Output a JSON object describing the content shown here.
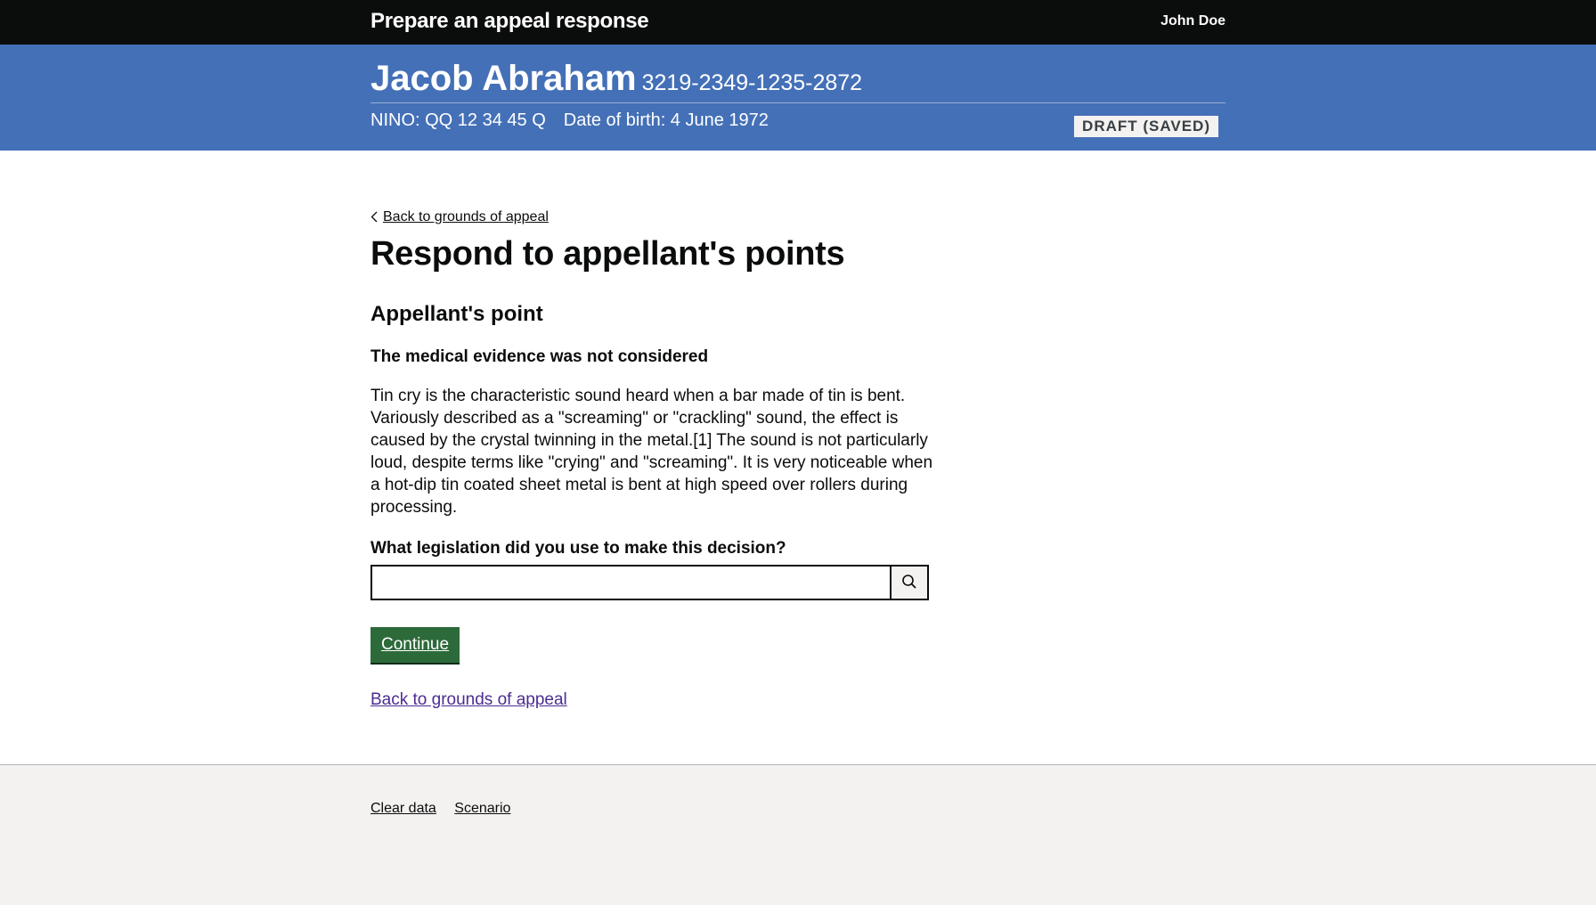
{
  "header": {
    "service_name": "Prepare an appeal response",
    "user_name": "John Doe"
  },
  "case_banner": {
    "name": "Jacob Abraham",
    "reference": "3219-2349-1235-2872",
    "status": "DRAFT (SAVED)",
    "nino": "NINO: QQ 12 34 45 Q",
    "dob": "Date of birth: 4 June 1972"
  },
  "main": {
    "back_link": "Back to grounds of appeal",
    "title": "Respond to appellant's points",
    "section_heading": "Appellant's point",
    "point_title": "The medical evidence was not considered",
    "point_body": "Tin cry is the characteristic sound heard when a bar made of tin is bent. Variously described as a \"screaming\" or \"crackling\" sound, the effect is caused by the crystal twinning in the metal.[1] The sound is not particularly loud, despite terms like \"crying\" and \"screaming\". It is very noticeable when a hot-dip tin coated sheet metal is bent at high speed over rollers during processing.",
    "legislation_label": "What legislation did you use to make this decision?",
    "legislation_value": "",
    "continue_label": "Continue",
    "back_link_bottom": "Back to grounds of appeal"
  },
  "footer": {
    "links": [
      "Clear data",
      "Scenario"
    ]
  },
  "colors": {
    "header_bg": "#0b0c0c",
    "banner_bg": "#4470b7",
    "button_bg": "#2d6a3a",
    "link_visited": "#4c2c92",
    "footer_bg": "#f3f2f1"
  },
  "icons": {
    "search": "search-icon",
    "back": "chevron-left-icon"
  }
}
